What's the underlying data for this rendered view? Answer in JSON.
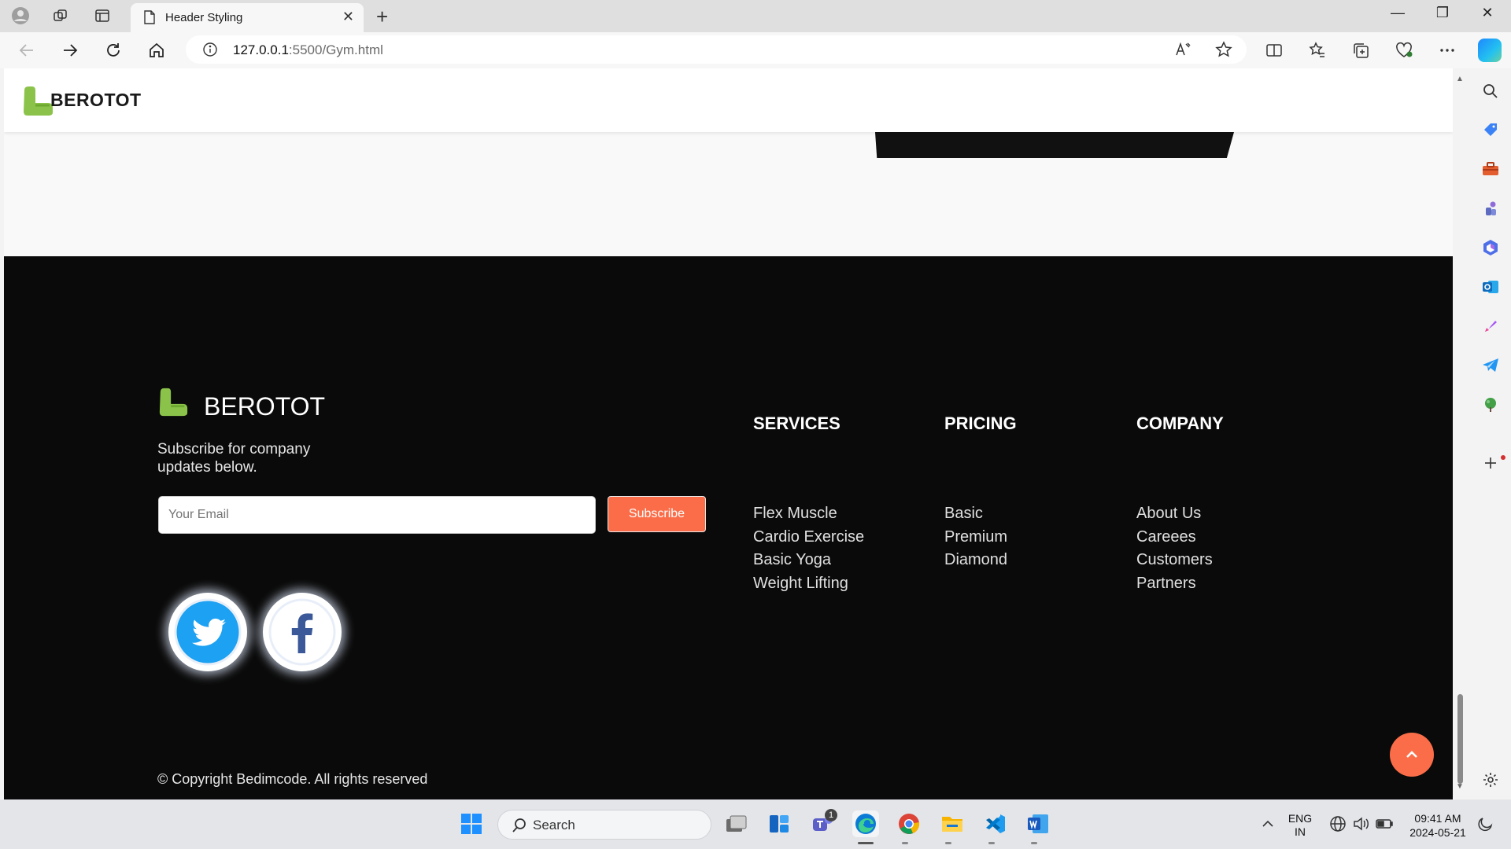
{
  "browser": {
    "tab_title": "Header Styling",
    "url_host": "127.0.0.1",
    "url_rest": ":5500/Gym.html",
    "new_tab_symbol": "+",
    "close_symbol": "✕",
    "win_minimize": "—",
    "win_restore": "❐",
    "win_close": "✕",
    "icons": [
      "profile-icon",
      "workspaces-icon",
      "tab-actions-icon",
      "page-icon",
      "back-icon",
      "forward-icon",
      "refresh-icon",
      "home-icon",
      "site-info-icon",
      "read-aloud-icon",
      "favorite-star-icon",
      "split-screen-icon",
      "favorites-icon",
      "collections-icon",
      "browser-essentials-icon",
      "more-icon",
      "copilot-icon"
    ]
  },
  "sidebar": {
    "icons": [
      "search-icon",
      "shopping-icon",
      "tools-icon",
      "games-icon",
      "microsoft-365-icon",
      "outlook-icon",
      "designer-icon",
      "telegram-icon",
      "tree-icon",
      "add-icon",
      "settings-icon"
    ]
  },
  "site": {
    "brand": "BEROTOT",
    "accent_color": "#fb6d49",
    "logo_color": "#8bc34a",
    "footer": {
      "brand": "BEROTOT",
      "tagline": "Subscribe for company updates below.",
      "email_placeholder": "Your Email",
      "subscribe_label": "Subscribe",
      "copyright": "© Copyright Bedimcode. All rights reserved",
      "columns": [
        {
          "title": "SERVICES",
          "items": [
            "Flex Muscle",
            "Cardio Exercise",
            "Basic Yoga",
            "Weight Lifting"
          ]
        },
        {
          "title": "PRICING",
          "items": [
            "Basic",
            "Premium",
            "Diamond"
          ]
        },
        {
          "title": "COMPANY",
          "items": [
            "About Us",
            "Careees",
            "Customers",
            "Partners"
          ]
        }
      ],
      "social": [
        "twitter-icon",
        "facebook-icon"
      ]
    }
  },
  "taskbar": {
    "search_label": "Search",
    "teams_badge": "1",
    "lang_line1": "ENG",
    "lang_line2": "IN",
    "time": "09:41 AM",
    "date": "2024-05-21"
  }
}
